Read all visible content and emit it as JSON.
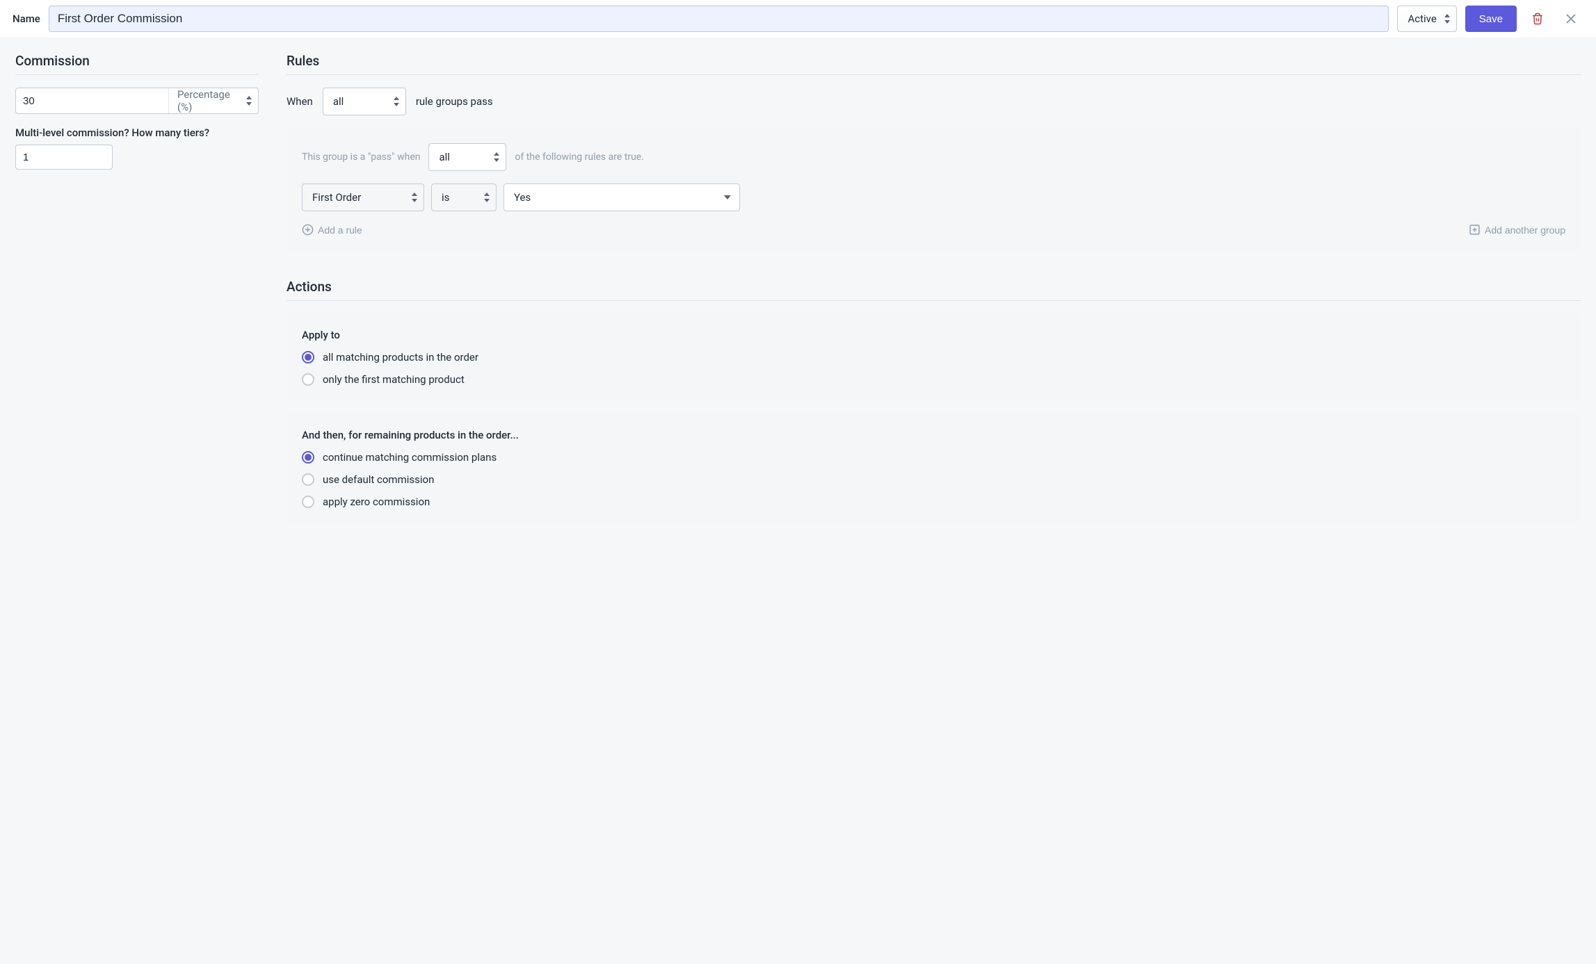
{
  "header": {
    "name_label": "Name",
    "name_value": "First Order Commission",
    "status_label": "Active",
    "save_label": "Save"
  },
  "commission": {
    "section_title": "Commission",
    "value": "30",
    "type_label": "Percentage (%)",
    "tiers_label": "Multi-level commission? How many tiers?",
    "tiers_value": "1"
  },
  "rules": {
    "section_title": "Rules",
    "when_label": "When",
    "when_mode": "all",
    "when_suffix": "rule groups pass",
    "group": {
      "prefix": "This group is a \"pass\" when",
      "mode": "all",
      "suffix": "of the following rules are true.",
      "rule": {
        "field": "First Order",
        "operator": "is",
        "value": "Yes"
      },
      "add_rule_label": "Add a rule",
      "add_group_label": "Add another group"
    }
  },
  "actions": {
    "section_title": "Actions",
    "apply_to": {
      "label": "Apply to",
      "option_all": "all matching products in the order",
      "option_first": "only the first matching product",
      "selected": "all"
    },
    "then": {
      "label": "And then, for remaining products in the order...",
      "option_continue": "continue matching commission plans",
      "option_default": "use default commission",
      "option_zero": "apply zero commission",
      "selected": "continue"
    }
  }
}
